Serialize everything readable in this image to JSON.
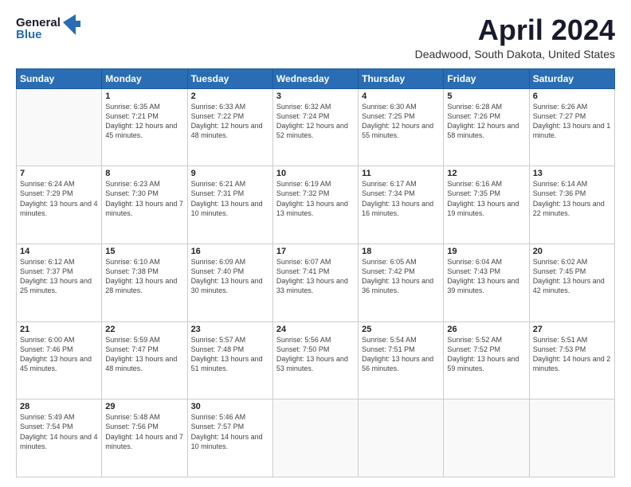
{
  "header": {
    "logo_line1": "General",
    "logo_line2": "Blue",
    "month": "April 2024",
    "location": "Deadwood, South Dakota, United States"
  },
  "days_of_week": [
    "Sunday",
    "Monday",
    "Tuesday",
    "Wednesday",
    "Thursday",
    "Friday",
    "Saturday"
  ],
  "weeks": [
    [
      {
        "day": "",
        "sunrise": "",
        "sunset": "",
        "daylight": "",
        "empty": true
      },
      {
        "day": "1",
        "sunrise": "Sunrise: 6:35 AM",
        "sunset": "Sunset: 7:21 PM",
        "daylight": "Daylight: 12 hours and 45 minutes."
      },
      {
        "day": "2",
        "sunrise": "Sunrise: 6:33 AM",
        "sunset": "Sunset: 7:22 PM",
        "daylight": "Daylight: 12 hours and 48 minutes."
      },
      {
        "day": "3",
        "sunrise": "Sunrise: 6:32 AM",
        "sunset": "Sunset: 7:24 PM",
        "daylight": "Daylight: 12 hours and 52 minutes."
      },
      {
        "day": "4",
        "sunrise": "Sunrise: 6:30 AM",
        "sunset": "Sunset: 7:25 PM",
        "daylight": "Daylight: 12 hours and 55 minutes."
      },
      {
        "day": "5",
        "sunrise": "Sunrise: 6:28 AM",
        "sunset": "Sunset: 7:26 PM",
        "daylight": "Daylight: 12 hours and 58 minutes."
      },
      {
        "day": "6",
        "sunrise": "Sunrise: 6:26 AM",
        "sunset": "Sunset: 7:27 PM",
        "daylight": "Daylight: 13 hours and 1 minute."
      }
    ],
    [
      {
        "day": "7",
        "sunrise": "Sunrise: 6:24 AM",
        "sunset": "Sunset: 7:29 PM",
        "daylight": "Daylight: 13 hours and 4 minutes."
      },
      {
        "day": "8",
        "sunrise": "Sunrise: 6:23 AM",
        "sunset": "Sunset: 7:30 PM",
        "daylight": "Daylight: 13 hours and 7 minutes."
      },
      {
        "day": "9",
        "sunrise": "Sunrise: 6:21 AM",
        "sunset": "Sunset: 7:31 PM",
        "daylight": "Daylight: 13 hours and 10 minutes."
      },
      {
        "day": "10",
        "sunrise": "Sunrise: 6:19 AM",
        "sunset": "Sunset: 7:32 PM",
        "daylight": "Daylight: 13 hours and 13 minutes."
      },
      {
        "day": "11",
        "sunrise": "Sunrise: 6:17 AM",
        "sunset": "Sunset: 7:34 PM",
        "daylight": "Daylight: 13 hours and 16 minutes."
      },
      {
        "day": "12",
        "sunrise": "Sunrise: 6:16 AM",
        "sunset": "Sunset: 7:35 PM",
        "daylight": "Daylight: 13 hours and 19 minutes."
      },
      {
        "day": "13",
        "sunrise": "Sunrise: 6:14 AM",
        "sunset": "Sunset: 7:36 PM",
        "daylight": "Daylight: 13 hours and 22 minutes."
      }
    ],
    [
      {
        "day": "14",
        "sunrise": "Sunrise: 6:12 AM",
        "sunset": "Sunset: 7:37 PM",
        "daylight": "Daylight: 13 hours and 25 minutes."
      },
      {
        "day": "15",
        "sunrise": "Sunrise: 6:10 AM",
        "sunset": "Sunset: 7:38 PM",
        "daylight": "Daylight: 13 hours and 28 minutes."
      },
      {
        "day": "16",
        "sunrise": "Sunrise: 6:09 AM",
        "sunset": "Sunset: 7:40 PM",
        "daylight": "Daylight: 13 hours and 30 minutes."
      },
      {
        "day": "17",
        "sunrise": "Sunrise: 6:07 AM",
        "sunset": "Sunset: 7:41 PM",
        "daylight": "Daylight: 13 hours and 33 minutes."
      },
      {
        "day": "18",
        "sunrise": "Sunrise: 6:05 AM",
        "sunset": "Sunset: 7:42 PM",
        "daylight": "Daylight: 13 hours and 36 minutes."
      },
      {
        "day": "19",
        "sunrise": "Sunrise: 6:04 AM",
        "sunset": "Sunset: 7:43 PM",
        "daylight": "Daylight: 13 hours and 39 minutes."
      },
      {
        "day": "20",
        "sunrise": "Sunrise: 6:02 AM",
        "sunset": "Sunset: 7:45 PM",
        "daylight": "Daylight: 13 hours and 42 minutes."
      }
    ],
    [
      {
        "day": "21",
        "sunrise": "Sunrise: 6:00 AM",
        "sunset": "Sunset: 7:46 PM",
        "daylight": "Daylight: 13 hours and 45 minutes."
      },
      {
        "day": "22",
        "sunrise": "Sunrise: 5:59 AM",
        "sunset": "Sunset: 7:47 PM",
        "daylight": "Daylight: 13 hours and 48 minutes."
      },
      {
        "day": "23",
        "sunrise": "Sunrise: 5:57 AM",
        "sunset": "Sunset: 7:48 PM",
        "daylight": "Daylight: 13 hours and 51 minutes."
      },
      {
        "day": "24",
        "sunrise": "Sunrise: 5:56 AM",
        "sunset": "Sunset: 7:50 PM",
        "daylight": "Daylight: 13 hours and 53 minutes."
      },
      {
        "day": "25",
        "sunrise": "Sunrise: 5:54 AM",
        "sunset": "Sunset: 7:51 PM",
        "daylight": "Daylight: 13 hours and 56 minutes."
      },
      {
        "day": "26",
        "sunrise": "Sunrise: 5:52 AM",
        "sunset": "Sunset: 7:52 PM",
        "daylight": "Daylight: 13 hours and 59 minutes."
      },
      {
        "day": "27",
        "sunrise": "Sunrise: 5:51 AM",
        "sunset": "Sunset: 7:53 PM",
        "daylight": "Daylight: 14 hours and 2 minutes."
      }
    ],
    [
      {
        "day": "28",
        "sunrise": "Sunrise: 5:49 AM",
        "sunset": "Sunset: 7:54 PM",
        "daylight": "Daylight: 14 hours and 4 minutes."
      },
      {
        "day": "29",
        "sunrise": "Sunrise: 5:48 AM",
        "sunset": "Sunset: 7:56 PM",
        "daylight": "Daylight: 14 hours and 7 minutes."
      },
      {
        "day": "30",
        "sunrise": "Sunrise: 5:46 AM",
        "sunset": "Sunset: 7:57 PM",
        "daylight": "Daylight: 14 hours and 10 minutes."
      },
      {
        "day": "",
        "sunrise": "",
        "sunset": "",
        "daylight": "",
        "empty": true
      },
      {
        "day": "",
        "sunrise": "",
        "sunset": "",
        "daylight": "",
        "empty": true
      },
      {
        "day": "",
        "sunrise": "",
        "sunset": "",
        "daylight": "",
        "empty": true
      },
      {
        "day": "",
        "sunrise": "",
        "sunset": "",
        "daylight": "",
        "empty": true
      }
    ]
  ]
}
